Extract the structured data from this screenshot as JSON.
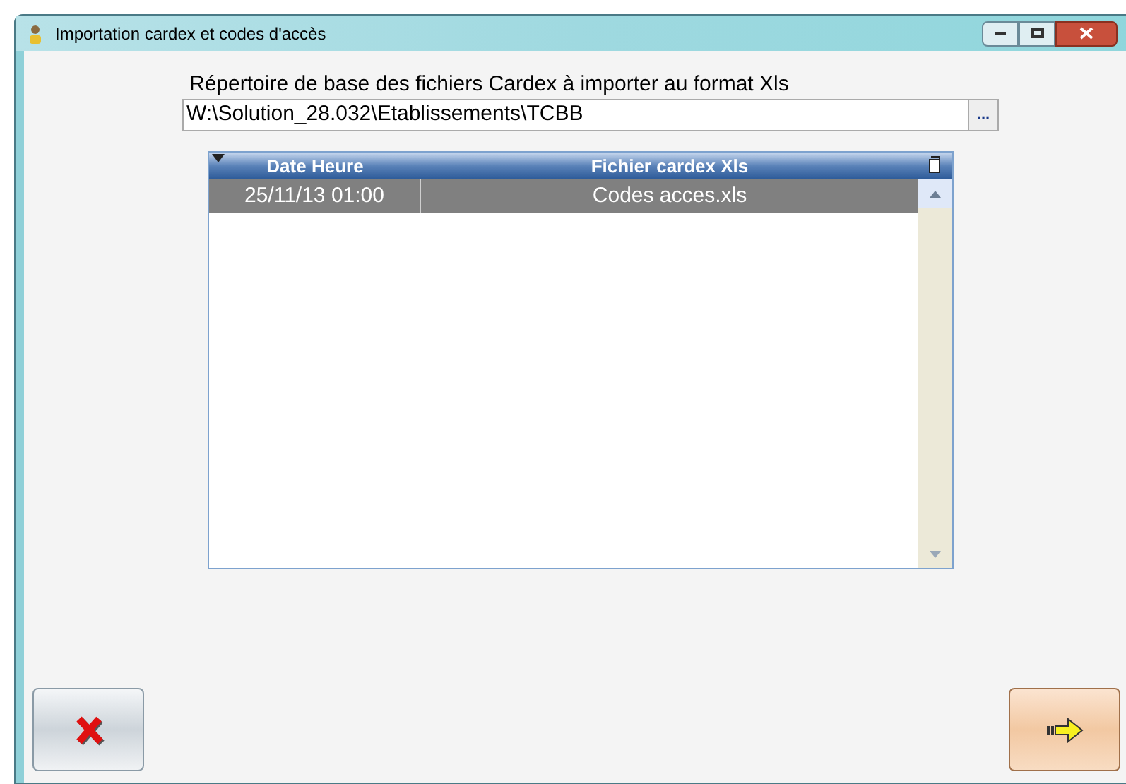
{
  "window": {
    "title": "Importation cardex et codes d'accès"
  },
  "folder": {
    "label": "Répertoire de base des fichiers Cardex à importer au format Xls",
    "value": "W:\\Solution_28.032\\Etablissements\\TCBB",
    "browse": "..."
  },
  "table": {
    "columns": [
      "Date Heure",
      "Fichier cardex Xls"
    ],
    "rows": [
      {
        "cells": [
          "25/11/13 01:00",
          "Codes acces.xls"
        ],
        "selected": true
      }
    ]
  }
}
